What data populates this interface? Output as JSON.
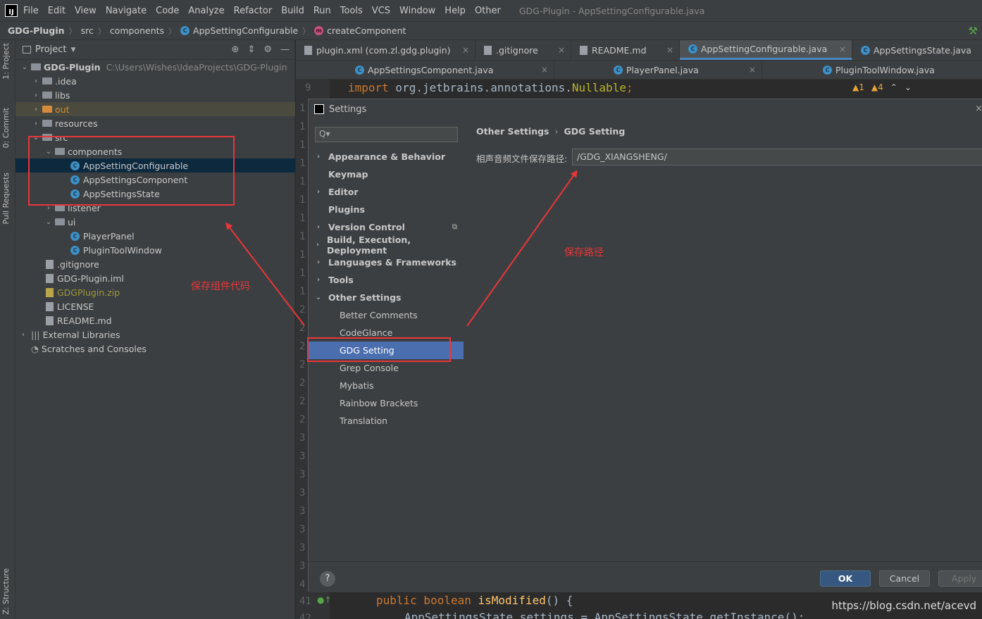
{
  "menu": {
    "items": [
      "File",
      "Edit",
      "View",
      "Navigate",
      "Code",
      "Analyze",
      "Refactor",
      "Build",
      "Run",
      "Tools",
      "VCS",
      "Window",
      "Help",
      "Other"
    ],
    "window_title": "GDG-Plugin - AppSettingConfigurable.java"
  },
  "breadcrumb": {
    "project": "GDG-Plugin",
    "src": "src",
    "pkg": "components",
    "cls": "AppSettingConfigurable",
    "method": "createComponent"
  },
  "left_strip": {
    "project": "1: Project",
    "commit": "0: Commit",
    "pull": "Pull Requests",
    "structure": "Z: Structure"
  },
  "project_panel": {
    "title": "Project",
    "root_name": "GDG-Plugin",
    "root_path": "C:\\Users\\Wishes\\IdeaProjects\\GDG-Plugin",
    "items": {
      "idea": ".idea",
      "libs": "libs",
      "out": "out",
      "resources": "resources",
      "src": "src",
      "components": "components",
      "c1": "AppSettingConfigurable",
      "c2": "AppSettingsComponent",
      "c3": "AppSettingsState",
      "listener": "listener",
      "ui": "ui",
      "u1": "PlayerPanel",
      "u2": "PluginToolWindow",
      "gitignore": ".gitignore",
      "iml": "GDG-Plugin.iml",
      "zip": "GDGPlugin.zip",
      "license": "LICENSE",
      "readme": "README.md",
      "extlib": "External Libraries",
      "scratch": "Scratches and Consoles"
    }
  },
  "tabs_row1": [
    "plugin.xml (com.zl.gdg.plugin)",
    ".gitignore",
    "README.md",
    "AppSettingConfigurable.java",
    "AppSettingsState.java"
  ],
  "tabs_row2": [
    "AppSettingsComponent.java",
    "PlayerPanel.java",
    "PluginToolWindow.java"
  ],
  "editor": {
    "line9_num": "9",
    "line9_kw": "import",
    "line9_pkg": " org.jetbrains.annotations.",
    "line9_ann": "Nullable",
    "line9_end": ";",
    "line41_num": "41",
    "line41_kw": "public boolean ",
    "line41_fn": "isModified",
    "line41_end": "() {",
    "line42_num": "42",
    "line42_code": "AppSettingsState settings = AppSettingsState.getInstance();",
    "warn_err": "▲1",
    "warn_warn": "▲4",
    "gutter_digits": [
      "1",
      "1",
      "1",
      "1",
      "1",
      "1",
      "1",
      "1",
      "1",
      "1",
      "1",
      "2",
      "2",
      "2",
      "2",
      "2",
      "2",
      "2",
      "3",
      "3",
      "3",
      "3",
      "3",
      "3",
      "3",
      "3",
      "4"
    ]
  },
  "settings": {
    "title": "Settings",
    "search_placeholder": "Q▾",
    "items": {
      "appearance": "Appearance & Behavior",
      "keymap": "Keymap",
      "editor": "Editor",
      "plugins": "Plugins",
      "vcs": "Version Control",
      "build": "Build, Execution, Deployment",
      "lang": "Languages & Frameworks",
      "tools": "Tools",
      "other": "Other Settings",
      "better": "Better Comments",
      "glance": "CodeGlance",
      "gdg": "GDG Setting",
      "grep": "Grep Console",
      "mybatis": "Mybatis",
      "rainbow": "Rainbow Brackets",
      "translation": "Translation"
    },
    "crumb_parent": "Other Settings",
    "crumb_current": "GDG Setting",
    "field_label": "相声音频文件保存路径:",
    "field_value": "/GDG_XIANGSHENG/",
    "buttons": {
      "help": "?",
      "ok": "OK",
      "cancel": "Cancel",
      "apply": "Apply"
    }
  },
  "annotations": {
    "note_components": "保存组件代码",
    "note_path": "保存路径",
    "watermark": "https://blog.csdn.net/acevd",
    "color": "#e8363a"
  }
}
